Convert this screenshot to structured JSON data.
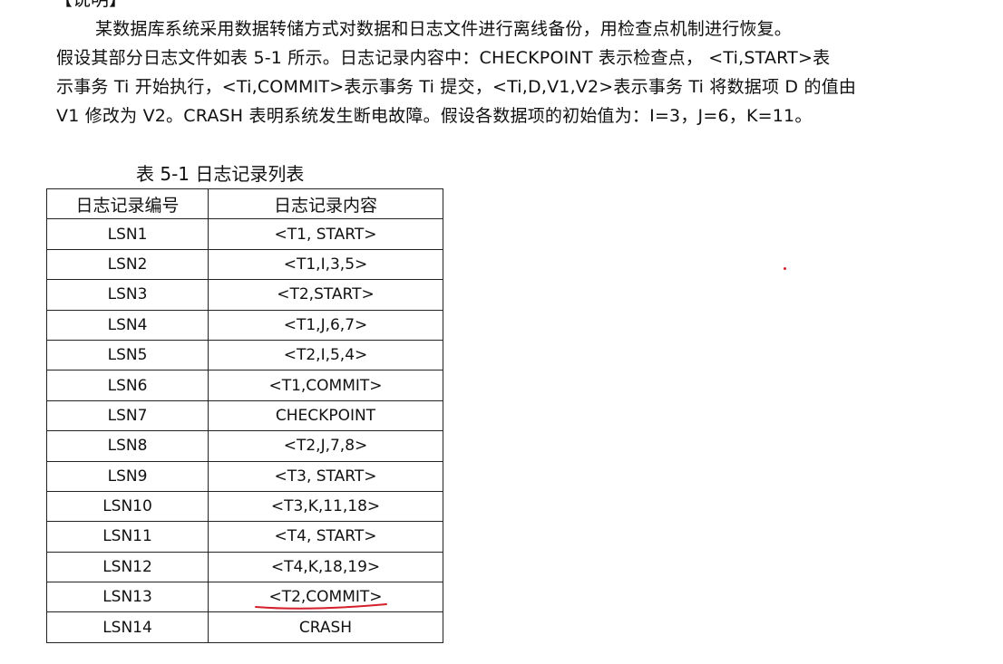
{
  "heading": "【说明】",
  "paragraph_lines": [
    "某数据库系统采用数据转储方式对数据和日志文件进行离线备份，用检查点机制进行恢复。",
    "假设其部分日志文件如表 5-1 所示。日志记录内容中：CHECKPOINT 表示检查点，  <Ti,START>表",
    "示事务 Ti 开始执行，<Ti,COMMIT>表示事务 Ti 提交，<Ti,D,V1,V2>表示事务 Ti 将数据项 D 的值由",
    "V1 修改为 V2。CRASH 表明系统发生断电故障。假设各数据项的初始值为：I=3，J=6，K=11。"
  ],
  "table": {
    "caption": "表 5-1    日志记录列表",
    "headers": [
      "日志记录编号",
      "日志记录内容"
    ],
    "rows": [
      [
        "LSN1",
        "<T1, START>"
      ],
      [
        "LSN2",
        "<T1,I,3,5>"
      ],
      [
        "LSN3",
        "<T2,START>"
      ],
      [
        "LSN4",
        "<T1,J,6,7>"
      ],
      [
        "LSN5",
        "<T2,I,5,4>"
      ],
      [
        "LSN6",
        "<T1,COMMIT>"
      ],
      [
        "LSN7",
        "CHECKPOINT"
      ],
      [
        "LSN8",
        "<T2,J,7,8>"
      ],
      [
        "LSN9",
        "<T3, START>"
      ],
      [
        "LSN10",
        "<T3,K,11,18>"
      ],
      [
        "LSN11",
        "<T4, START>"
      ],
      [
        "LSN12",
        "<T4,K,18,19>"
      ],
      [
        "LSN13",
        "<T2,COMMIT>"
      ],
      [
        "LSN14",
        "CRASH"
      ]
    ]
  },
  "annotation_color": "#d4202a"
}
